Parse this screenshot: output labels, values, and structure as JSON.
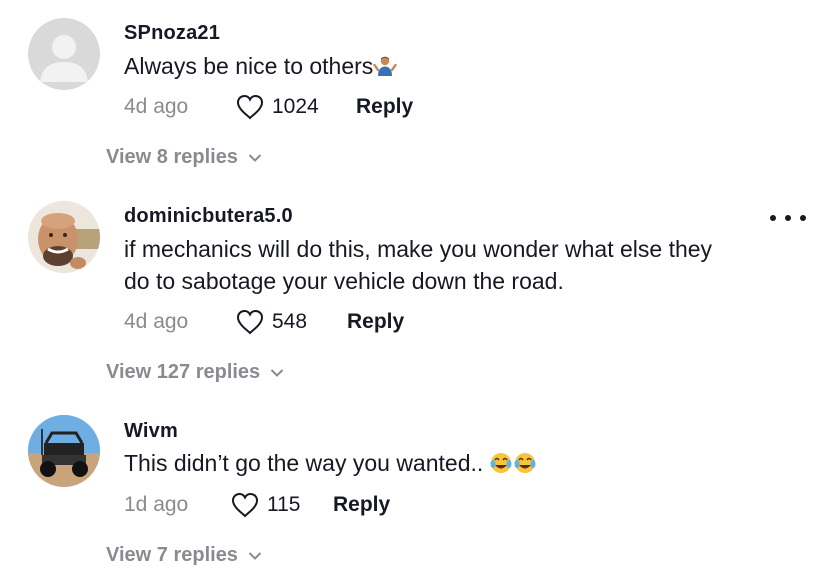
{
  "comments": [
    {
      "username": "SPnoza21",
      "text": "Always be nice to others",
      "emoji": "shrug-emoji",
      "time": "4d ago",
      "likes": "1024",
      "reply_label": "Reply",
      "view_replies": "View 8 replies"
    },
    {
      "username": "dominicbutera5.0",
      "text": "if mechanics will do this, make you wonder what else they do to sabotage your vehicle down the road.",
      "time": "4d ago",
      "likes": "548",
      "reply_label": "Reply",
      "view_replies": "View 127 replies"
    },
    {
      "username": "Wivm",
      "text": "This didn’t go the way you wanted.. ",
      "emoji": "tears-of-joy-emoji",
      "time": "1d ago",
      "likes": "115",
      "reply_label": "Reply",
      "view_replies": "View 7 replies"
    }
  ],
  "colors": {
    "text": "#161823",
    "muted": "#8a8b91",
    "background": "#ffffff"
  }
}
